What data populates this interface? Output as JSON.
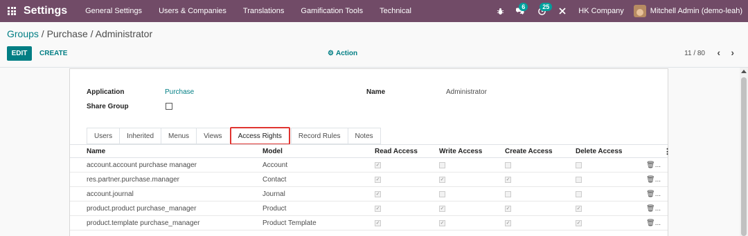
{
  "navbar": {
    "app_title": "Settings",
    "menu": [
      "General Settings",
      "Users & Companies",
      "Translations",
      "Gamification Tools",
      "Technical"
    ],
    "messages_badge": "6",
    "activities_badge": "25",
    "company": "HK Company",
    "user": "Mitchell Admin (demo-leah)",
    "accent_color": "#714b67"
  },
  "control_panel": {
    "breadcrumb": {
      "root": "Groups",
      "separator": " / ",
      "current": "Purchase / Administrator"
    },
    "edit_label": "EDIT",
    "create_label": "CREATE",
    "action_label": "Action",
    "pager": "11 / 80",
    "pager_prev": "‹",
    "pager_next": "›"
  },
  "form": {
    "application_label": "Application",
    "application_value": "Purchase",
    "share_group_label": "Share Group",
    "name_label": "Name",
    "name_value": "Administrator"
  },
  "tabs": [
    "Users",
    "Inherited",
    "Menus",
    "Views",
    "Access Rights",
    "Record Rules",
    "Notes"
  ],
  "active_tab": "Access Rights",
  "table": {
    "columns": [
      "Name",
      "Model",
      "Read Access",
      "Write Access",
      "Create Access",
      "Delete Access"
    ],
    "rows": [
      {
        "name": "account.account purchase manager",
        "model": "Account",
        "read": true,
        "write": false,
        "create": false,
        "delete": false
      },
      {
        "name": "res.partner.purchase.manager",
        "model": "Contact",
        "read": true,
        "write": true,
        "create": true,
        "delete": false
      },
      {
        "name": "account.journal",
        "model": "Journal",
        "read": true,
        "write": false,
        "create": false,
        "delete": false
      },
      {
        "name": "product.product purchase_manager",
        "model": "Product",
        "read": true,
        "write": true,
        "create": true,
        "delete": true
      },
      {
        "name": "product.template purchase_manager",
        "model": "Product Template",
        "read": true,
        "write": true,
        "create": true,
        "delete": true
      }
    ],
    "trash_label": "🗑..."
  }
}
